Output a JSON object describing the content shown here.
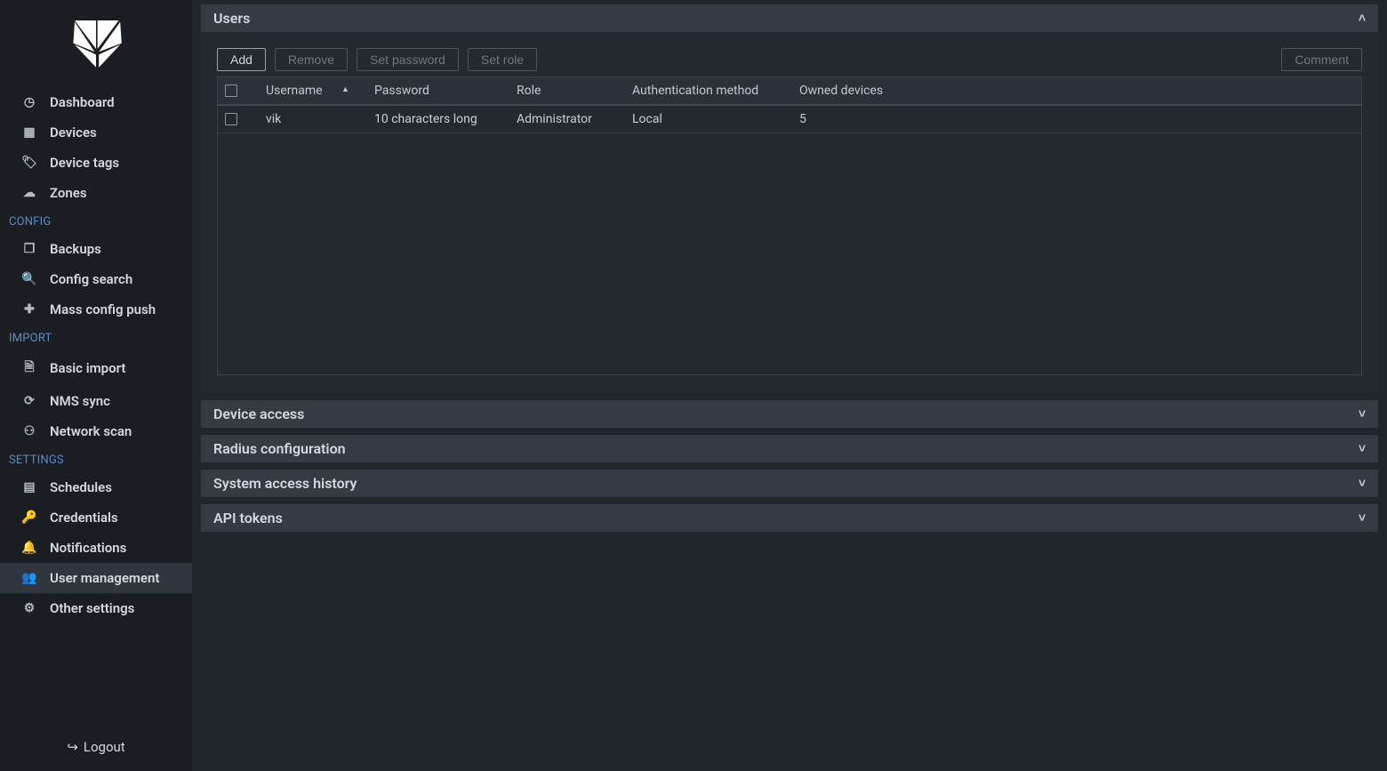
{
  "sidebar": {
    "groups": [
      {
        "title": null,
        "items": [
          {
            "key": "dashboard",
            "label": "Dashboard",
            "icon": "gauge-icon"
          },
          {
            "key": "devices",
            "label": "Devices",
            "icon": "grid-icon"
          },
          {
            "key": "device-tags",
            "label": "Device tags",
            "icon": "tags-icon"
          },
          {
            "key": "zones",
            "label": "Zones",
            "icon": "cloud-icon"
          }
        ]
      },
      {
        "title": "CONFIG",
        "items": [
          {
            "key": "backups",
            "label": "Backups",
            "icon": "copy-icon"
          },
          {
            "key": "config-search",
            "label": "Config search",
            "icon": "search-icon"
          },
          {
            "key": "mass-config",
            "label": "Mass config push",
            "icon": "puzzle-icon"
          }
        ]
      },
      {
        "title": "IMPORT",
        "items": [
          {
            "key": "basic-import",
            "label": "Basic import",
            "icon": "file-icon"
          },
          {
            "key": "nms-sync",
            "label": "NMS sync",
            "icon": "sync-icon"
          },
          {
            "key": "network-scan",
            "label": "Network scan",
            "icon": "sitemap-icon"
          }
        ]
      },
      {
        "title": "SETTINGS",
        "items": [
          {
            "key": "schedules",
            "label": "Schedules",
            "icon": "calendar-icon"
          },
          {
            "key": "credentials",
            "label": "Credentials",
            "icon": "key-icon"
          },
          {
            "key": "notifications",
            "label": "Notifications",
            "icon": "bell-icon"
          },
          {
            "key": "user-management",
            "label": "User management",
            "icon": "users-icon",
            "active": true
          },
          {
            "key": "other-settings",
            "label": "Other settings",
            "icon": "sliders-icon"
          }
        ]
      }
    ],
    "logout_label": "Logout"
  },
  "panels": {
    "users": {
      "title": "Users",
      "expanded": true,
      "toolbar": {
        "add": "Add",
        "remove": "Remove",
        "set_password": "Set password",
        "set_role": "Set role",
        "comment": "Comment"
      },
      "columns": {
        "username": "Username",
        "password": "Password",
        "role": "Role",
        "auth_method": "Authentication method",
        "owned_devices": "Owned devices"
      },
      "sort_indicator": "▲",
      "rows": [
        {
          "username": "vik",
          "password": "10 characters long",
          "role": "Administrator",
          "auth_method": "Local",
          "owned_devices": "5"
        }
      ]
    },
    "device_access": {
      "title": "Device access",
      "expanded": false
    },
    "radius_config": {
      "title": "Radius configuration",
      "expanded": false
    },
    "access_history": {
      "title": "System access history",
      "expanded": false
    },
    "api_tokens": {
      "title": "API tokens",
      "expanded": false
    }
  },
  "icons": {
    "gauge-icon": "◷",
    "grid-icon": "▦",
    "tags-icon": "🏷",
    "cloud-icon": "☁",
    "copy-icon": "❐",
    "search-icon": "🔍",
    "puzzle-icon": "✚",
    "file-icon": "🗎",
    "sync-icon": "⟳",
    "sitemap-icon": "⚇",
    "calendar-icon": "▤",
    "key-icon": "🔑",
    "bell-icon": "🔔",
    "users-icon": "👥",
    "sliders-icon": "⚙",
    "logout-icon": "↪",
    "chevron-up": "˄",
    "chevron-down": "˅"
  }
}
